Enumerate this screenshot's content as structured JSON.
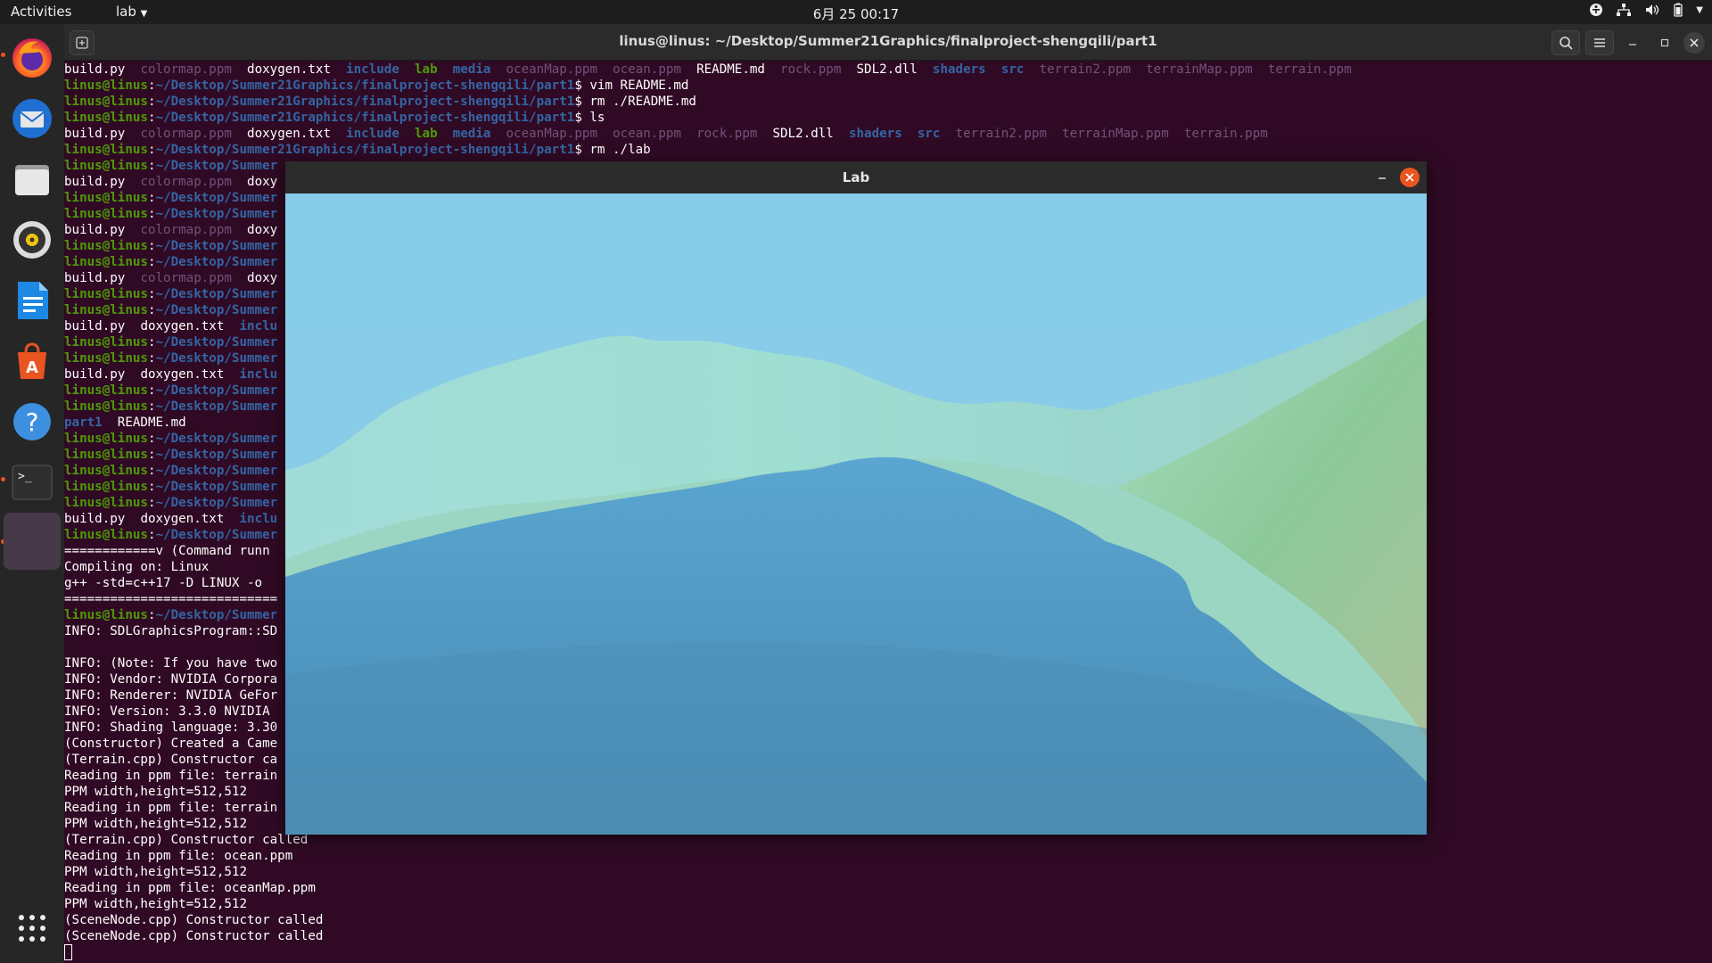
{
  "topbar": {
    "activities": "Activities",
    "app_menu": "lab",
    "clock": "6月 25  00:17"
  },
  "terminal": {
    "title": "linus@linus: ~/Desktop/Summer21Graphics/finalproject-shengqili/part1",
    "lines": [
      [
        [
          "build.py",
          "n"
        ],
        [
          "  ",
          "n"
        ],
        [
          "colormap.ppm",
          "img"
        ],
        [
          "  ",
          "n"
        ],
        [
          "doxygen.txt",
          "n"
        ],
        [
          "  ",
          "n"
        ],
        [
          "include",
          "dir"
        ],
        [
          "  ",
          "n"
        ],
        [
          "lab",
          "exe"
        ],
        [
          "  ",
          "n"
        ],
        [
          "media",
          "dir"
        ],
        [
          "  ",
          "n"
        ],
        [
          "oceanMap.ppm",
          "img"
        ],
        [
          "  ",
          "n"
        ],
        [
          "ocean.ppm",
          "img"
        ],
        [
          "  ",
          "n"
        ],
        [
          "README.md",
          "n"
        ],
        [
          "  ",
          "n"
        ],
        [
          "rock.ppm",
          "img"
        ],
        [
          "  ",
          "n"
        ],
        [
          "SDL2.dll",
          "n"
        ],
        [
          "  ",
          "n"
        ],
        [
          "shaders",
          "dir"
        ],
        [
          "  ",
          "n"
        ],
        [
          "src",
          "dir"
        ],
        [
          "  ",
          "n"
        ],
        [
          "terrain2.ppm",
          "img"
        ],
        [
          "  ",
          "n"
        ],
        [
          "terrainMap.ppm",
          "img"
        ],
        [
          "  ",
          "n"
        ],
        [
          "terrain.ppm",
          "img"
        ]
      ],
      [
        [
          "linus@linus",
          "usr"
        ],
        [
          ":",
          "n"
        ],
        [
          "~/Desktop/Summer21Graphics/finalproject-shengqili/part1",
          "pth"
        ],
        [
          "$ vim README.md",
          "n"
        ]
      ],
      [
        [
          "linus@linus",
          "usr"
        ],
        [
          ":",
          "n"
        ],
        [
          "~/Desktop/Summer21Graphics/finalproject-shengqili/part1",
          "pth"
        ],
        [
          "$ rm ./README.md",
          "n"
        ]
      ],
      [
        [
          "linus@linus",
          "usr"
        ],
        [
          ":",
          "n"
        ],
        [
          "~/Desktop/Summer21Graphics/finalproject-shengqili/part1",
          "pth"
        ],
        [
          "$ ls",
          "n"
        ]
      ],
      [
        [
          "build.py",
          "n"
        ],
        [
          "  ",
          "n"
        ],
        [
          "colormap.ppm",
          "img"
        ],
        [
          "  ",
          "n"
        ],
        [
          "doxygen.txt",
          "n"
        ],
        [
          "  ",
          "n"
        ],
        [
          "include",
          "dir"
        ],
        [
          "  ",
          "n"
        ],
        [
          "lab",
          "exe"
        ],
        [
          "  ",
          "n"
        ],
        [
          "media",
          "dir"
        ],
        [
          "  ",
          "n"
        ],
        [
          "oceanMap.ppm",
          "img"
        ],
        [
          "  ",
          "n"
        ],
        [
          "ocean.ppm",
          "img"
        ],
        [
          "  ",
          "n"
        ],
        [
          "rock.ppm",
          "img"
        ],
        [
          "  ",
          "n"
        ],
        [
          "SDL2.dll",
          "n"
        ],
        [
          "  ",
          "n"
        ],
        [
          "shaders",
          "dir"
        ],
        [
          "  ",
          "n"
        ],
        [
          "src",
          "dir"
        ],
        [
          "  ",
          "n"
        ],
        [
          "terrain2.ppm",
          "img"
        ],
        [
          "  ",
          "n"
        ],
        [
          "terrainMap.ppm",
          "img"
        ],
        [
          "  ",
          "n"
        ],
        [
          "terrain.ppm",
          "img"
        ]
      ],
      [
        [
          "linus@linus",
          "usr"
        ],
        [
          ":",
          "n"
        ],
        [
          "~/Desktop/Summer21Graphics/finalproject-shengqili/part1",
          "pth"
        ],
        [
          "$ rm ./lab",
          "n"
        ]
      ],
      [
        [
          "linus@linus",
          "usr"
        ],
        [
          ":",
          "n"
        ],
        [
          "~/Desktop/Summer",
          "pth"
        ]
      ],
      [
        [
          "build.py",
          "n"
        ],
        [
          "  ",
          "n"
        ],
        [
          "colormap.ppm",
          "img"
        ],
        [
          "  ",
          "n"
        ],
        [
          "doxy",
          "n"
        ]
      ],
      [
        [
          "linus@linus",
          "usr"
        ],
        [
          ":",
          "n"
        ],
        [
          "~/Desktop/Summer",
          "pth"
        ]
      ],
      [
        [
          "linus@linus",
          "usr"
        ],
        [
          ":",
          "n"
        ],
        [
          "~/Desktop/Summer",
          "pth"
        ]
      ],
      [
        [
          "build.py",
          "n"
        ],
        [
          "  ",
          "n"
        ],
        [
          "colormap.ppm",
          "img"
        ],
        [
          "  ",
          "n"
        ],
        [
          "doxy",
          "n"
        ]
      ],
      [
        [
          "linus@linus",
          "usr"
        ],
        [
          ":",
          "n"
        ],
        [
          "~/Desktop/Summer",
          "pth"
        ]
      ],
      [
        [
          "linus@linus",
          "usr"
        ],
        [
          ":",
          "n"
        ],
        [
          "~/Desktop/Summer",
          "pth"
        ]
      ],
      [
        [
          "build.py",
          "n"
        ],
        [
          "  ",
          "n"
        ],
        [
          "colormap.ppm",
          "img"
        ],
        [
          "  ",
          "n"
        ],
        [
          "doxy",
          "n"
        ]
      ],
      [
        [
          "linus@linus",
          "usr"
        ],
        [
          ":",
          "n"
        ],
        [
          "~/Desktop/Summer",
          "pth"
        ]
      ],
      [
        [
          "linus@linus",
          "usr"
        ],
        [
          ":",
          "n"
        ],
        [
          "~/Desktop/Summer",
          "pth"
        ]
      ],
      [
        [
          "build.py",
          "n"
        ],
        [
          "  ",
          "n"
        ],
        [
          "doxygen.txt",
          "n"
        ],
        [
          "  ",
          "n"
        ],
        [
          "inclu",
          "dir"
        ]
      ],
      [
        [
          "linus@linus",
          "usr"
        ],
        [
          ":",
          "n"
        ],
        [
          "~/Desktop/Summer",
          "pth"
        ]
      ],
      [
        [
          "linus@linus",
          "usr"
        ],
        [
          ":",
          "n"
        ],
        [
          "~/Desktop/Summer",
          "pth"
        ]
      ],
      [
        [
          "build.py",
          "n"
        ],
        [
          "  ",
          "n"
        ],
        [
          "doxygen.txt",
          "n"
        ],
        [
          "  ",
          "n"
        ],
        [
          "inclu",
          "dir"
        ]
      ],
      [
        [
          "linus@linus",
          "usr"
        ],
        [
          ":",
          "n"
        ],
        [
          "~/Desktop/Summer",
          "pth"
        ]
      ],
      [
        [
          "linus@linus",
          "usr"
        ],
        [
          ":",
          "n"
        ],
        [
          "~/Desktop/Summer",
          "pth"
        ]
      ],
      [
        [
          "part1",
          "dir"
        ],
        [
          "  README.md",
          "n"
        ]
      ],
      [
        [
          "linus@linus",
          "usr"
        ],
        [
          ":",
          "n"
        ],
        [
          "~/Desktop/Summer",
          "pth"
        ]
      ],
      [
        [
          "linus@linus",
          "usr"
        ],
        [
          ":",
          "n"
        ],
        [
          "~/Desktop/Summer",
          "pth"
        ]
      ],
      [
        [
          "linus@linus",
          "usr"
        ],
        [
          ":",
          "n"
        ],
        [
          "~/Desktop/Summer",
          "pth"
        ]
      ],
      [
        [
          "linus@linus",
          "usr"
        ],
        [
          ":",
          "n"
        ],
        [
          "~/Desktop/Summer",
          "pth"
        ]
      ],
      [
        [
          "linus@linus",
          "usr"
        ],
        [
          ":",
          "n"
        ],
        [
          "~/Desktop/Summer",
          "pth"
        ]
      ],
      [
        [
          "build.py",
          "n"
        ],
        [
          "  ",
          "n"
        ],
        [
          "doxygen.txt",
          "n"
        ],
        [
          "  ",
          "n"
        ],
        [
          "inclu",
          "dir"
        ]
      ],
      [
        [
          "linus@linus",
          "usr"
        ],
        [
          ":",
          "n"
        ],
        [
          "~/Desktop/Summer",
          "pth"
        ]
      ],
      [
        [
          "============v (Command runn",
          "n"
        ]
      ],
      [
        [
          "Compiling on: Linux",
          "n"
        ]
      ],
      [
        [
          "g++ -std=c++17 -D LINUX -o ",
          "n"
        ]
      ],
      [
        [
          "============================",
          "n"
        ]
      ],
      [
        [
          "linus@linus",
          "usr"
        ],
        [
          ":",
          "n"
        ],
        [
          "~/Desktop/Summer",
          "pth"
        ]
      ],
      [
        [
          "INFO: SDLGraphicsProgram::SD",
          "n"
        ]
      ],
      [
        [
          "",
          "n"
        ]
      ],
      [
        [
          "INFO: (Note: If you have two",
          "n"
        ]
      ],
      [
        [
          "INFO: Vendor: NVIDIA Corpora",
          "n"
        ]
      ],
      [
        [
          "INFO: Renderer: NVIDIA GeFor",
          "n"
        ]
      ],
      [
        [
          "INFO: Version: 3.3.0 NVIDIA ",
          "n"
        ]
      ],
      [
        [
          "INFO: Shading language: 3.30",
          "n"
        ]
      ],
      [
        [
          "(Constructor) Created a Came",
          "n"
        ]
      ],
      [
        [
          "(Terrain.cpp) Constructor ca",
          "n"
        ]
      ],
      [
        [
          "Reading in ppm file: terrain",
          "n"
        ]
      ],
      [
        [
          "PPM width,height=512,512",
          "n"
        ]
      ],
      [
        [
          "Reading in ppm file: terrain",
          "n"
        ]
      ],
      [
        [
          "PPM width,height=512,512",
          "n"
        ]
      ],
      [
        [
          "(Terrain.cpp) Constructor called",
          "n"
        ]
      ],
      [
        [
          "Reading in ppm file: ocean.ppm",
          "n"
        ]
      ],
      [
        [
          "PPM width,height=512,512",
          "n"
        ]
      ],
      [
        [
          "Reading in ppm file: oceanMap.ppm",
          "n"
        ]
      ],
      [
        [
          "PPM width,height=512,512",
          "n"
        ]
      ],
      [
        [
          "(SceneNode.cpp) Constructor called",
          "n"
        ]
      ],
      [
        [
          "(SceneNode.cpp) Constructor called",
          "n"
        ]
      ]
    ]
  },
  "lab_window": {
    "title": "Lab"
  },
  "dock": {
    "items": [
      {
        "name": "firefox-icon",
        "running": true
      },
      {
        "name": "thunderbird-icon",
        "running": false
      },
      {
        "name": "files-icon",
        "running": false
      },
      {
        "name": "rhythmbox-icon",
        "running": false
      },
      {
        "name": "writer-icon",
        "running": false
      },
      {
        "name": "software-icon",
        "running": false
      },
      {
        "name": "help-icon",
        "running": false
      },
      {
        "name": "terminal-icon",
        "running": true
      },
      {
        "name": "lab-app-icon",
        "running": true
      }
    ],
    "show_apps_icon": "show-applications-icon"
  },
  "colors": {
    "accent": "#e95420",
    "terminal_bg": "#300a24",
    "user_green": "#4e9a06",
    "path_blue": "#3465a4"
  }
}
